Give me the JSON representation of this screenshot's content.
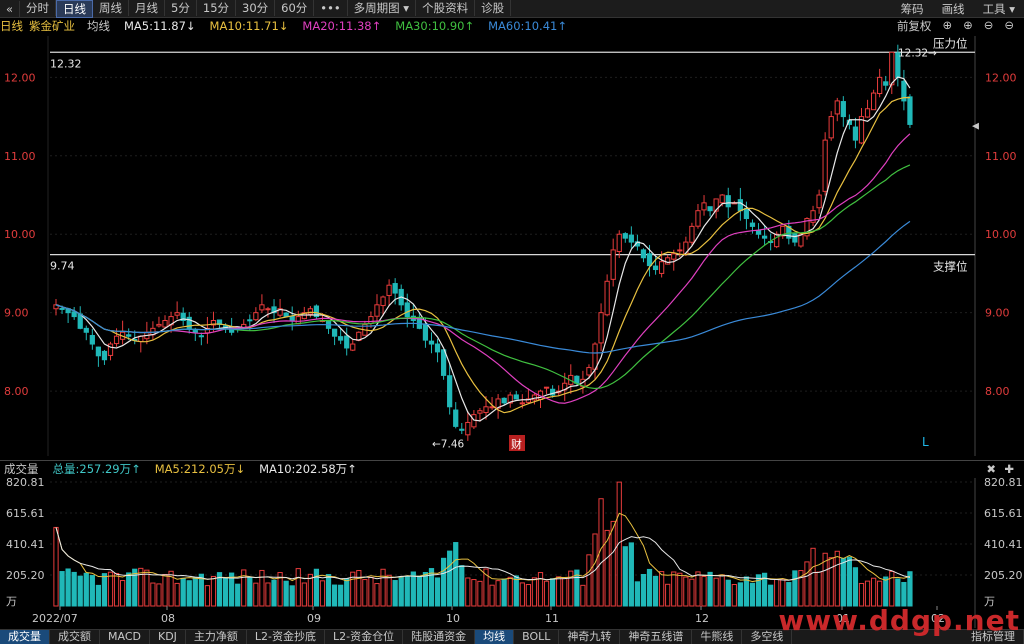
{
  "toolbar": {
    "back_icon": "«",
    "tabs": [
      "分时",
      "日线",
      "周线",
      "月线",
      "5分",
      "15分",
      "30分",
      "60分",
      "•••",
      "多周期图 ▾",
      "个股资料",
      "诊股"
    ],
    "active": "日线",
    "right": [
      "筹码",
      "画线",
      "工具 ▾"
    ]
  },
  "ma_legend": {
    "period": "日线",
    "name": "紫金矿业",
    "label": "均线",
    "items": [
      {
        "text": "MA5:11.87↓",
        "color": "#e8e8e8"
      },
      {
        "text": "MA10:11.71↓",
        "color": "#e8c040"
      },
      {
        "text": "MA20:11.38↑",
        "color": "#e040c0"
      },
      {
        "text": "MA30:10.90↑",
        "color": "#40c040"
      },
      {
        "text": "MA60:10.41↑",
        "color": "#3a8ad8"
      }
    ],
    "right": [
      "前复权",
      "⊕",
      "⊕",
      "⊖",
      "⊖"
    ]
  },
  "price_axis": [
    "12.00",
    "11.00",
    "10.00",
    "9.00",
    "8.00"
  ],
  "annotations": {
    "resistance": "压力位",
    "support": "支撑位",
    "high_left": "12.32",
    "high_right": "12.32→",
    "low_left": "9.74",
    "low_mark": "←7.46",
    "fin_badge": "财",
    "L_mark": "L"
  },
  "volume_legend": {
    "label": "成交量",
    "items": [
      {
        "text": "总量:257.29万↑",
        "color": "#40c8c8"
      },
      {
        "text": "MA5:212.05万↓",
        "color": "#e8c040"
      },
      {
        "text": "MA10:202.58万↑",
        "color": "#e8e8e8"
      }
    ]
  },
  "volume_axis": [
    "820.81",
    "615.61",
    "410.41",
    "205.20",
    "万"
  ],
  "date_axis": [
    "2022/07",
    "08",
    "09",
    "10",
    "11",
    "12",
    "01",
    "02"
  ],
  "bottom_tabs": [
    "成交量",
    "成交额",
    "MACD",
    "KDJ",
    "主力净额",
    "L2-资金抄底",
    "L2-资金仓位",
    "陆股通资金",
    "均线",
    "BOLL",
    "神奇九转",
    "神奇五线谱",
    "牛熊线",
    "多空线"
  ],
  "bottom_active": [
    "成交量",
    "均线"
  ],
  "bottom_right": "指标管理",
  "watermark": "www.ddgp.net",
  "chart_data": {
    "type": "candlestick",
    "ylim": [
      7.3,
      12.4
    ],
    "resistance": 12.32,
    "support": 9.74,
    "volume_ylim": [
      0,
      820.81
    ],
    "closes": [
      9.1,
      9.05,
      9.0,
      8.95,
      8.8,
      8.75,
      8.6,
      8.45,
      8.4,
      8.6,
      8.7,
      8.75,
      8.7,
      8.65,
      8.7,
      8.75,
      8.8,
      8.85,
      8.9,
      8.95,
      9.0,
      8.9,
      8.8,
      8.75,
      8.7,
      8.8,
      8.9,
      8.85,
      8.8,
      8.75,
      8.8,
      8.85,
      8.9,
      9.0,
      9.1,
      9.05,
      9.0,
      9.05,
      8.95,
      8.9,
      8.95,
      9.0,
      9.05,
      8.95,
      8.9,
      8.8,
      8.7,
      8.65,
      8.55,
      8.6,
      8.75,
      8.85,
      8.95,
      9.1,
      9.2,
      9.35,
      9.25,
      9.1,
      8.95,
      8.9,
      8.8,
      8.65,
      8.6,
      8.5,
      8.2,
      7.8,
      7.55,
      7.5,
      7.6,
      7.7,
      7.75,
      7.8,
      7.8,
      7.9,
      7.85,
      7.95,
      7.9,
      7.85,
      7.9,
      7.95,
      8.0,
      8.05,
      7.95,
      8.0,
      8.1,
      8.2,
      8.1,
      8.15,
      8.3,
      8.6,
      9.0,
      9.4,
      9.8,
      10.0,
      9.95,
      9.9,
      9.85,
      9.7,
      9.6,
      9.55,
      9.65,
      9.7,
      9.75,
      9.8,
      9.9,
      10.1,
      10.3,
      10.4,
      10.3,
      10.45,
      10.5,
      10.35,
      10.4,
      10.3,
      10.2,
      10.1,
      10.0,
      9.95,
      9.9,
      10.0,
      10.1,
      9.95,
      9.9,
      10.0,
      10.2,
      10.3,
      10.5,
      11.2,
      11.5,
      11.7,
      11.5,
      11.4,
      11.2,
      11.5,
      11.6,
      11.8,
      12.0,
      11.9,
      12.32,
      12.0,
      11.7,
      11.4
    ]
  }
}
